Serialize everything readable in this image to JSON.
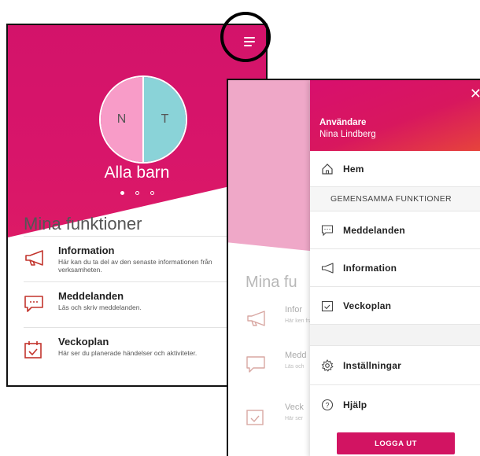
{
  "colors": {
    "accent": "#d3136a",
    "drawer_gradient_end": "#e7463a",
    "logout": "#d21462"
  },
  "main_screen": {
    "avatar": {
      "left_initial": "N",
      "right_initial": "T"
    },
    "all_kids_label": "Alla barn",
    "section_title": "Mina funktioner",
    "items": [
      {
        "icon": "megaphone-icon",
        "title": "Information",
        "desc": "Här kan du ta del av den senaste informationen från verksamheten."
      },
      {
        "icon": "chat-icon",
        "title": "Meddelanden",
        "desc": "Läs och skriv meddelanden."
      },
      {
        "icon": "calendar-check-icon",
        "title": "Veckoplan",
        "desc": "Här ser du planerade händelser och aktiviteter."
      }
    ]
  },
  "background_screen": {
    "section_title": "Mina fu",
    "items": [
      {
        "title": "Infor",
        "desc": "Här ken från ver"
      },
      {
        "title": "Medd",
        "desc": "Läs och"
      },
      {
        "title": "Veck",
        "desc": "Här ser"
      }
    ]
  },
  "drawer": {
    "user_label": "Användare",
    "user_name": "Nina Lindberg",
    "home": "Hem",
    "section_label": "GEMENSAMMA FUNKTIONER",
    "items": [
      "Meddelanden",
      "Information",
      "Veckoplan"
    ],
    "settings": "Inställningar",
    "help": "Hjälp",
    "logout": "LOGGA UT"
  }
}
